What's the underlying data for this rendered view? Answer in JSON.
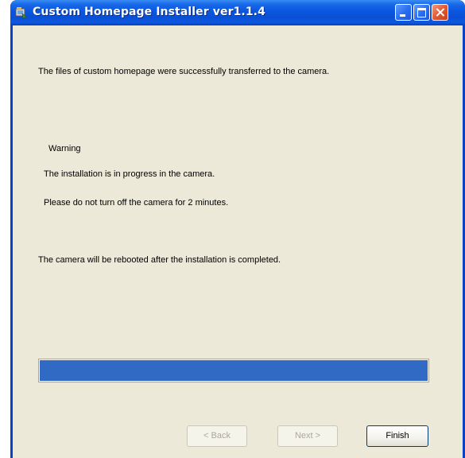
{
  "window": {
    "title": "Custom Homepage Installer  ver1.1.4",
    "icon": "installer-app-icon",
    "controls": {
      "minimize": "minimize-icon",
      "maximize": "maximize-icon",
      "close": "close-icon"
    }
  },
  "messages": {
    "success": "The files of custom homepage were successfully transferred to the camera.",
    "warning_heading": "Warning",
    "warning_line1": "The installation is in progress in the camera.",
    "warning_line2": "Please do not turn off the camera for 2 minutes.",
    "reboot_note": "The camera will be rebooted after the installation is completed."
  },
  "progress": {
    "value_percent": 100,
    "fill_color": "#316ac5"
  },
  "buttons": {
    "back": "< Back",
    "next": "Next >",
    "finish": "Finish"
  },
  "colors": {
    "titlebar": "#0a50d6",
    "client_background": "#ece9d8",
    "close_button": "#e25a32"
  }
}
